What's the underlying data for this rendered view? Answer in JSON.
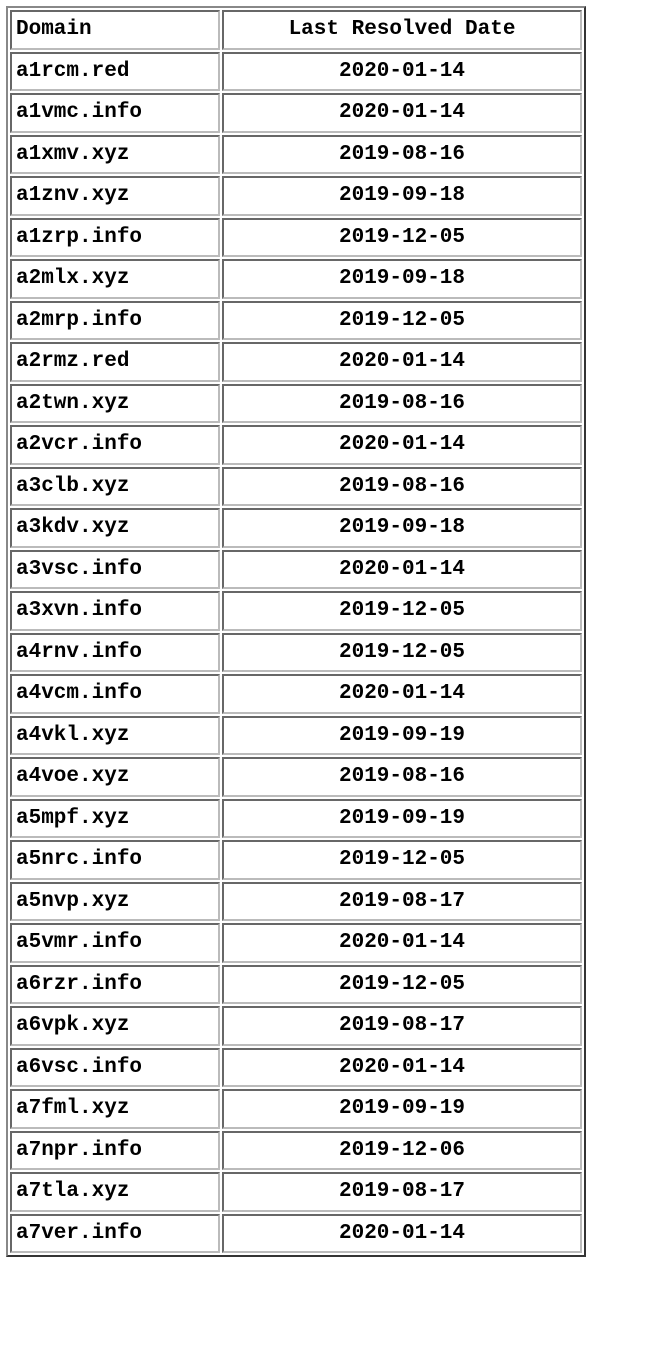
{
  "table": {
    "headers": {
      "domain": "Domain",
      "date": "Last Resolved Date"
    },
    "rows": [
      {
        "domain": "a1rcm.red",
        "date": "2020-01-14"
      },
      {
        "domain": "a1vmc.info",
        "date": "2020-01-14"
      },
      {
        "domain": "a1xmv.xyz",
        "date": "2019-08-16"
      },
      {
        "domain": "a1znv.xyz",
        "date": "2019-09-18"
      },
      {
        "domain": "a1zrp.info",
        "date": "2019-12-05"
      },
      {
        "domain": "a2mlx.xyz",
        "date": "2019-09-18"
      },
      {
        "domain": "a2mrp.info",
        "date": "2019-12-05"
      },
      {
        "domain": "a2rmz.red",
        "date": "2020-01-14"
      },
      {
        "domain": "a2twn.xyz",
        "date": "2019-08-16"
      },
      {
        "domain": "a2vcr.info",
        "date": "2020-01-14"
      },
      {
        "domain": "a3clb.xyz",
        "date": "2019-08-16"
      },
      {
        "domain": "a3kdv.xyz",
        "date": "2019-09-18"
      },
      {
        "domain": "a3vsc.info",
        "date": "2020-01-14"
      },
      {
        "domain": "a3xvn.info",
        "date": "2019-12-05"
      },
      {
        "domain": "a4rnv.info",
        "date": "2019-12-05"
      },
      {
        "domain": "a4vcm.info",
        "date": "2020-01-14"
      },
      {
        "domain": "a4vkl.xyz",
        "date": "2019-09-19"
      },
      {
        "domain": "a4voe.xyz",
        "date": "2019-08-16"
      },
      {
        "domain": "a5mpf.xyz",
        "date": "2019-09-19"
      },
      {
        "domain": "a5nrc.info",
        "date": "2019-12-05"
      },
      {
        "domain": "a5nvp.xyz",
        "date": "2019-08-17"
      },
      {
        "domain": "a5vmr.info",
        "date": "2020-01-14"
      },
      {
        "domain": "a6rzr.info",
        "date": "2019-12-05"
      },
      {
        "domain": "a6vpk.xyz",
        "date": "2019-08-17"
      },
      {
        "domain": "a6vsc.info",
        "date": "2020-01-14"
      },
      {
        "domain": "a7fml.xyz",
        "date": "2019-09-19"
      },
      {
        "domain": "a7npr.info",
        "date": "2019-12-06"
      },
      {
        "domain": "a7tla.xyz",
        "date": "2019-08-17"
      },
      {
        "domain": "a7ver.info",
        "date": "2020-01-14"
      }
    ]
  }
}
